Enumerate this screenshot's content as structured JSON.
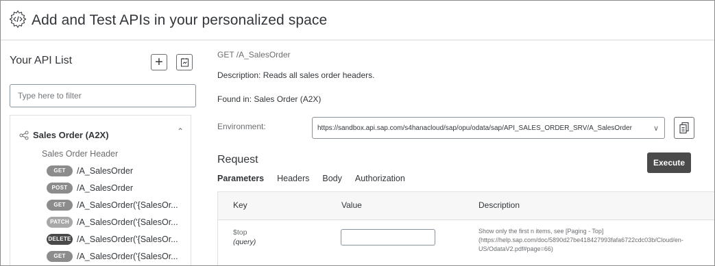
{
  "header": {
    "title": "Add and Test APIs in your personalized space",
    "logo_icon": "api-hub-gear-icon"
  },
  "sidebar": {
    "title": "Your API List",
    "add_icon": "plus-icon",
    "doc_icon": "document-icon",
    "filter_placeholder": "Type here to filter",
    "group": {
      "title": "Sales Order (A2X)",
      "icon": "share-icon",
      "collapse_icon": "chevron-up-icon",
      "subheading": "Sales Order Header",
      "endpoints": [
        {
          "method": "GET",
          "path": "/A_SalesOrder"
        },
        {
          "method": "POST",
          "path": "/A_SalesOrder"
        },
        {
          "method": "GET",
          "path": "/A_SalesOrder('{SalesOr..."
        },
        {
          "method": "PATCH",
          "path": "/A_SalesOrder('{SalesOr..."
        },
        {
          "method": "DELETE",
          "path": "/A_SalesOrder('{SalesOr..."
        },
        {
          "method": "GET",
          "path": "/A_SalesOrder('{SalesOr..."
        }
      ]
    }
  },
  "main": {
    "method_path": "GET /A_SalesOrder",
    "description": "Description: Reads all sales order headers.",
    "found_in": "Found in: Sales Order (A2X)",
    "environment_label": "Environment:",
    "environment_value": "https://sandbox.api.sap.com/s4hanacloud/sap/opu/odata/sap/API_SALES_ORDER_SRV/A_SalesOrder",
    "copy_icon": "copy-icon",
    "request_title": "Request",
    "execute_label": "Execute",
    "tabs": [
      "Parameters",
      "Headers",
      "Body",
      "Authorization"
    ],
    "active_tab": "Parameters",
    "table": {
      "headers": {
        "key": "Key",
        "value": "Value",
        "description": "Description"
      },
      "rows": [
        {
          "key": "$top",
          "type": "(query)",
          "value": "",
          "description": "Show only the first n items, see [Paging - Top] (https://help.sap.com/doc/5890d27be418427993fafa6722cdc03b/Cloud/en-US/OdataV2.pdf#page=66)"
        }
      ]
    }
  },
  "colors": {
    "badge_dark": "#4a4a4a",
    "badge_gray": "#8c8c8c",
    "execute_bg": "#4a4a4a"
  }
}
